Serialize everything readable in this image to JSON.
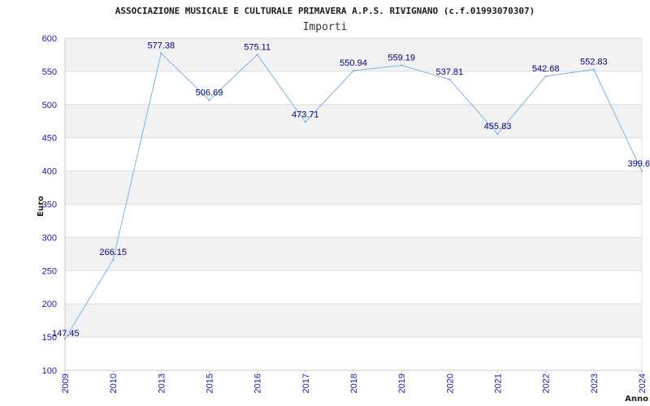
{
  "chart_data": {
    "type": "line",
    "title": "ASSOCIAZIONE MUSICALE E CULTURALE PRIMAVERA A.P.S. RIVIGNANO (c.f.01993070307)",
    "subtitle": "Importi",
    "xlabel": "Anno",
    "ylabel": "Euro",
    "x": [
      "2009",
      "2010",
      "2013",
      "2015",
      "2016",
      "2017",
      "2018",
      "2019",
      "2020",
      "2021",
      "2022",
      "2023",
      "2024"
    ],
    "values": [
      147.45,
      266.15,
      577.38,
      506.69,
      575.11,
      473.71,
      550.94,
      559.19,
      537.81,
      455.83,
      542.68,
      552.83,
      399.6
    ],
    "labels": [
      "147.45",
      "266.15",
      "577.38",
      "506.69",
      "575.11",
      "473.71",
      "550.94",
      "559.19",
      "537.81",
      "455.83",
      "542.68",
      "552.83",
      "399.6"
    ],
    "yticks": [
      100,
      150,
      200,
      250,
      300,
      350,
      400,
      450,
      500,
      550,
      600
    ],
    "ylim": [
      100,
      600
    ],
    "grid": true,
    "colors": {
      "line": "#7ab4e8",
      "tick_text": "#1a1aa0",
      "label_text": "#000080",
      "band": "#f2f2f2",
      "grid": "#dddddd"
    }
  }
}
